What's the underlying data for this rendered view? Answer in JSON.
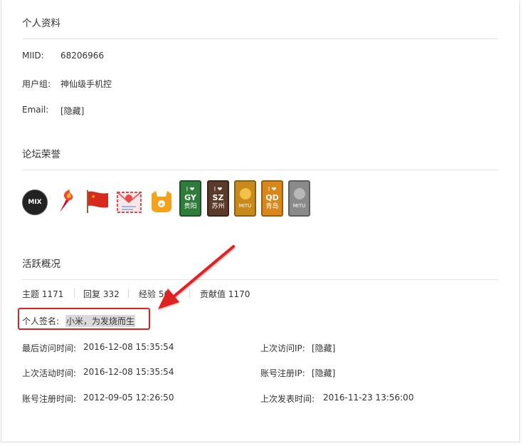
{
  "profile": {
    "title": "个人资料",
    "miid_label": "MIID:",
    "miid_value": "68206966",
    "group_label": "用户组:",
    "group_value": "神仙级手机控",
    "email_label": "Email:",
    "email_value": "[隐藏]"
  },
  "honors": {
    "title": "论坛荣誉",
    "badges": [
      {
        "name": "mix-badge",
        "text": "MIX",
        "color": "#222222"
      },
      {
        "name": "torch-badge",
        "color": "#e23b2a"
      },
      {
        "name": "flag-badge",
        "color": "#d82a1c"
      },
      {
        "name": "mail-badge",
        "color": "#e44a4a"
      },
      {
        "name": "mitu-badge",
        "color": "#f5a21b"
      },
      {
        "name": "city-badge-guiyang",
        "line1": "I ❤",
        "line2": "GY",
        "line3": "贵阳",
        "color": "#2f7d3b"
      },
      {
        "name": "city-badge-suzhou",
        "line1": "I ❤",
        "line2": "SZ",
        "line3": "苏州",
        "color": "#5b3a29"
      },
      {
        "name": "mitu-gold-badge",
        "line3": "MITU",
        "color": "#c98a1a"
      },
      {
        "name": "city-badge-qingdao",
        "line1": "I ❤",
        "line2": "QD",
        "line3": "青岛",
        "color": "#d9861a"
      },
      {
        "name": "mitu-gray-badge",
        "line3": "MITU",
        "color": "#8a8a8a"
      }
    ]
  },
  "activity": {
    "title": "活跃概况",
    "topics_label": "主题",
    "topics_value": "1171",
    "replies_label": "回复",
    "replies_value": "332",
    "exp_label": "经验",
    "exp_value": "56",
    "contrib_label": "贡献值",
    "contrib_value": "1170",
    "signature_label": "个人签名:",
    "signature_value": "小米，为发烧而生",
    "last_visit_label": "最后访问时间:",
    "last_visit_value": "2016-12-08 15:35:54",
    "last_visit_ip_label": "上次访问IP:",
    "last_visit_ip_value": "[隐藏]",
    "last_active_label": "上次活动时间:",
    "last_active_value": "2016-12-08 15:35:54",
    "reg_ip_label": "账号注册IP:",
    "reg_ip_value": "[隐藏]",
    "reg_time_label": "账号注册时间:",
    "reg_time_value": "2012-09-05 12:26:50",
    "last_post_label": "上次发表时间:",
    "last_post_value": "2016-11-23 13:56:00"
  },
  "annotation": {
    "color": "#e02020"
  }
}
